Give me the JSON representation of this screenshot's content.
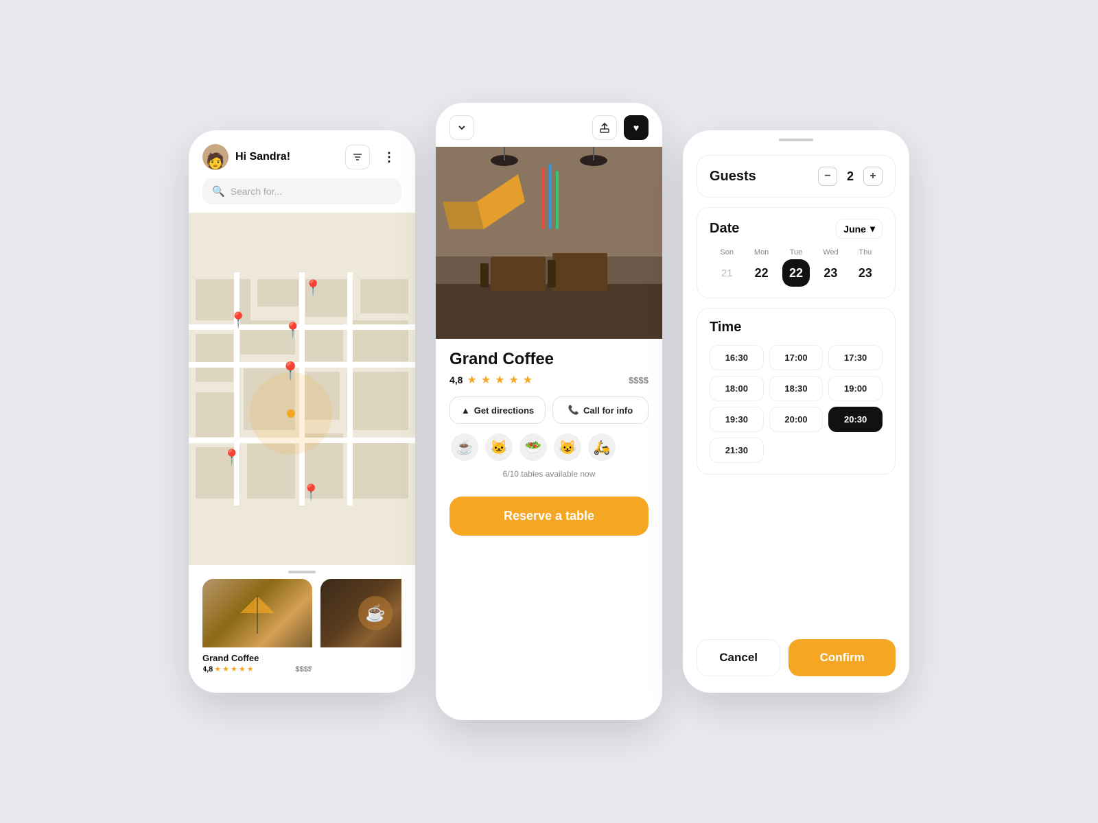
{
  "screen1": {
    "greeting": "Hi Sandra!",
    "search_placeholder": "Search for...",
    "filter_icon": "⚙",
    "more_icon": "⋮",
    "card": {
      "name": "Grand Coffee",
      "rating": "4,8",
      "price": "$$$$",
      "stars": 5
    }
  },
  "screen2": {
    "restaurant_name": "Grand Coffee",
    "rating": "4,8",
    "price": "$$$$",
    "stars": 5,
    "get_directions": "Get directions",
    "call_for_info": "Call for info",
    "emojis": [
      "☕",
      "🐱",
      "🥗",
      "😺",
      "🛵"
    ],
    "tables_info": "6/10 tables available now",
    "reserve_btn": "Reserve a table"
  },
  "screen3": {
    "notch": true,
    "guests_label": "Guests",
    "guests_count": "2",
    "date_label": "Date",
    "month": "June",
    "calendar": [
      {
        "day": "Son",
        "num": "21",
        "type": "light"
      },
      {
        "day": "Mon",
        "num": "22",
        "type": "normal"
      },
      {
        "day": "Tue",
        "num": "22",
        "type": "selected"
      },
      {
        "day": "Wed",
        "num": "23",
        "type": "normal"
      },
      {
        "day": "Thu",
        "num": "23",
        "type": "normal"
      }
    ],
    "time_label": "Time",
    "times": [
      {
        "label": "16:30",
        "selected": false
      },
      {
        "label": "17:00",
        "selected": false
      },
      {
        "label": "17:30",
        "selected": false
      },
      {
        "label": "18:00",
        "selected": false
      },
      {
        "label": "18:30",
        "selected": false
      },
      {
        "label": "19:00",
        "selected": false
      },
      {
        "label": "19:30",
        "selected": false
      },
      {
        "label": "20:00",
        "selected": false
      },
      {
        "label": "20:30",
        "selected": true
      },
      {
        "label": "21:30",
        "selected": false
      }
    ],
    "cancel_label": "Cancel",
    "confirm_label": "Confirm"
  }
}
